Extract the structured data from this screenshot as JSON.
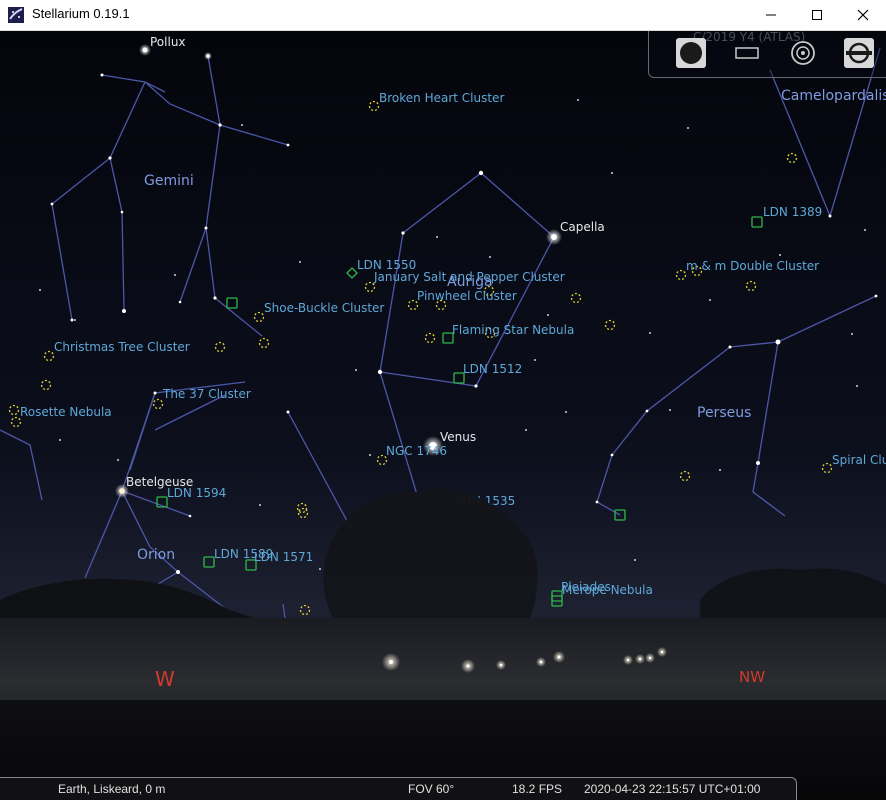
{
  "window": {
    "title": "Stellarium 0.19.1",
    "controls": {
      "minimize": "minimize-icon",
      "maximize": "maximize-icon",
      "close": "close-icon"
    }
  },
  "colors": {
    "sky_top": "#04050c",
    "sky_bottom": "#1a1d2a",
    "constellation_line": "#4c57a8",
    "constellation_label": "#7f9ce0",
    "dso_label": "#5fa8d8",
    "dso_cluster": "#e0d030",
    "dso_nebula": "#2fb84a",
    "star_label": "#e8e8e8",
    "cardinal": "#d23a2a"
  },
  "sky": {
    "top_label": "C/2019 Y4 (ATLAS)",
    "constellations": [
      "Gemini",
      "Auriga",
      "Orion",
      "Perseus",
      "Camelopardalis"
    ],
    "stars": [
      "Pollux",
      "Capella",
      "Betelgeuse"
    ],
    "planet": "Venus",
    "dso": {
      "broken_heart": "Broken Heart Cluster",
      "ldn1550": "LDN 1550",
      "january_salt": "January Salt and Pepper Cluster",
      "pinwheel": "Pinwheel Cluster",
      "flaming_star": "Flaming Star Nebula",
      "ldn1512": "LDN 1512",
      "ngc1746": "NGC 1746",
      "ldn1535": "LDN 1535",
      "shoe_buckle": "Shoe-Buckle Cluster",
      "christmas_tree": "Christmas Tree Cluster",
      "the37": "The 37 Cluster",
      "rosette": "Rosette Nebula",
      "ldn1594": "LDN 1594",
      "ldn1589": "LDN 1589",
      "ldn1571": "LDN 1571",
      "ldn1389": "LDN 1389",
      "mm_double": "m & m Double Cluster",
      "spiral": "Spiral Cluster",
      "pleiades": "Pleiades",
      "merope": "Merope Nebula"
    },
    "cardinals": {
      "west": "W",
      "northwest": "NW"
    }
  },
  "toolbar": {
    "buttons": [
      "planet-icon",
      "display-icon",
      "target-icon",
      "tools-icon"
    ]
  },
  "statusbar": {
    "location": "Earth, Liskeard, 0 m",
    "fov": "FOV 60°",
    "fps": "18.2 FPS",
    "datetime": "2020-04-23 22:15:57 UTC+01:00"
  }
}
